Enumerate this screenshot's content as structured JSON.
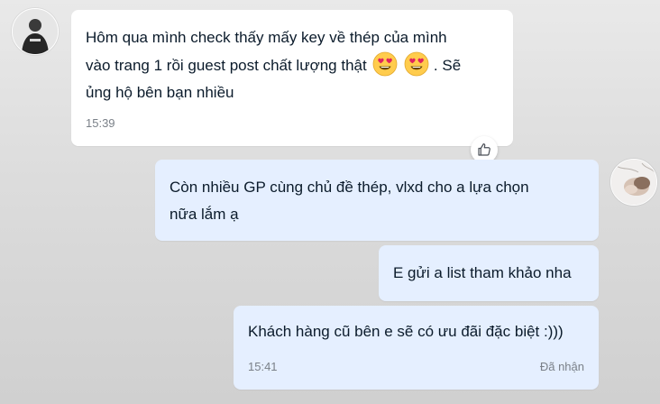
{
  "conversation": {
    "incoming": {
      "avatar_icon": "user-avatar-dark",
      "message": {
        "text_line1": "Hôm qua mình check thấy mấy key về thép của mình",
        "text_line2_before_emoji": "vào trang 1 rồi guest post chất lượng thật",
        "emoji_1": "smiling-face-with-heart-eyes",
        "emoji_2": "smiling-face-with-heart-eyes",
        "text_line2_after_emoji": ". Sẽ",
        "text_line3": "ủng hộ bên bạn nhiều",
        "time": "15:39"
      },
      "reaction_icon": "thumbs-up-icon"
    },
    "outgoing": {
      "avatar_icon": "user-avatar-light",
      "messages": [
        {
          "text_line1": "Còn nhiều GP cùng chủ đề thép, vlxd cho a lựa chọn",
          "text_line2": "nữa lắm ạ"
        },
        {
          "text": "E gửi a list tham khảo nha"
        },
        {
          "text": "Khách hàng cũ bên e sẽ có ưu đãi đặc biệt :)))",
          "time": "15:41",
          "status": "Đã nhận"
        }
      ]
    }
  },
  "colors": {
    "incoming_bubble": "#ffffff",
    "outgoing_bubble": "#e5efff",
    "text": "#0b1b2b",
    "meta_text": "#7a8088"
  }
}
